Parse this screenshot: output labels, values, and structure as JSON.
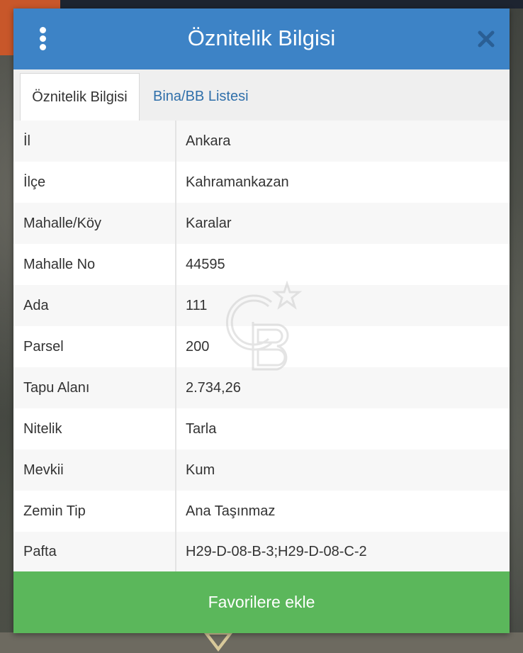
{
  "dialog": {
    "title": "Öznitelik Bilgisi",
    "header_color": "#3d83c6"
  },
  "tabs": [
    {
      "label": "Öznitelik Bilgisi",
      "active": true
    },
    {
      "label": "Bina/BB Listesi",
      "active": false
    }
  ],
  "attributes": [
    {
      "key": "İl",
      "value": "Ankara"
    },
    {
      "key": "İlçe",
      "value": "Kahramankazan"
    },
    {
      "key": "Mahalle/Köy",
      "value": "Karalar"
    },
    {
      "key": "Mahalle No",
      "value": "44595"
    },
    {
      "key": "Ada",
      "value": "111"
    },
    {
      "key": "Parsel",
      "value": "200"
    },
    {
      "key": "Tapu Alanı",
      "value": "2.734,26"
    },
    {
      "key": "Nitelik",
      "value": "Tarla"
    },
    {
      "key": "Mevkii",
      "value": "Kum"
    },
    {
      "key": "Zemin Tip",
      "value": "Ana Taşınmaz"
    },
    {
      "key": "Pafta",
      "value": "H29-D-08-B-3;H29-D-08-C-2"
    }
  ],
  "actions": {
    "favorite_label": "Favorilere ekle",
    "favorite_color": "#5bb75b"
  },
  "icons": {
    "menu": "vertical-dots-icon",
    "close": "close-icon"
  }
}
